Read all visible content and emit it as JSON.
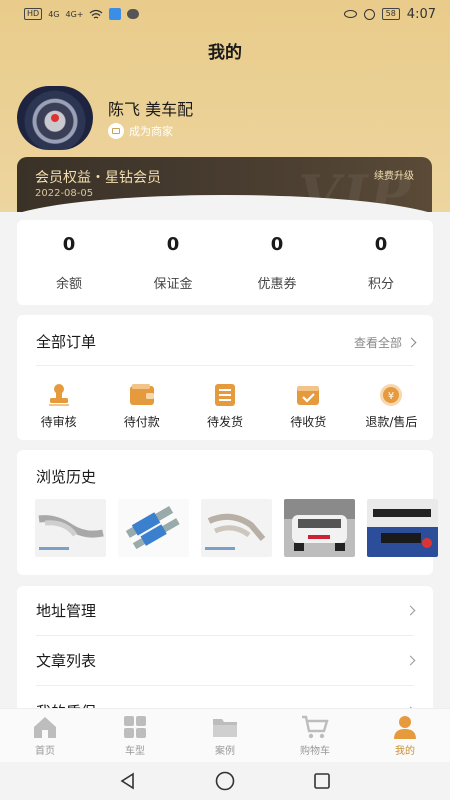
{
  "status_bar": {
    "left_badges": [
      "HD",
      "4G",
      "4G+"
    ],
    "battery": "58",
    "time": "4:07"
  },
  "page": {
    "title": "我的"
  },
  "profile": {
    "name": "陈飞 美车配",
    "merchant_label": "成为商家"
  },
  "vip": {
    "title": "会员权益・星钻会员",
    "date": "2022-08-05",
    "renew_label": "续费升级",
    "watermark": "VIP"
  },
  "stats": [
    {
      "value": "0",
      "label": "余额"
    },
    {
      "value": "0",
      "label": "保证金"
    },
    {
      "value": "0",
      "label": "优惠券"
    },
    {
      "value": "0",
      "label": "积分"
    }
  ],
  "orders": {
    "title": "全部订单",
    "see_all": "查看全部",
    "items": [
      {
        "label": "待审核",
        "icon": "stamp-icon"
      },
      {
        "label": "待付款",
        "icon": "wallet-icon"
      },
      {
        "label": "待发货",
        "icon": "list-icon"
      },
      {
        "label": "待收货",
        "icon": "box-check-icon"
      },
      {
        "label": "退款/售后",
        "icon": "refund-icon"
      }
    ]
  },
  "history": {
    "title": "浏览历史",
    "items": [
      "exhaust-pipe",
      "coilover-shocks",
      "exhaust-manifold",
      "white-suv-rear",
      "rear-diffuser"
    ]
  },
  "menu": [
    {
      "label": "地址管理"
    },
    {
      "label": "文章列表"
    },
    {
      "label": "我的质保"
    }
  ],
  "tabs": [
    {
      "label": "首页",
      "icon": "home-icon",
      "active": false
    },
    {
      "label": "车型",
      "icon": "grid-icon",
      "active": false
    },
    {
      "label": "案例",
      "icon": "folder-icon",
      "active": false
    },
    {
      "label": "购物车",
      "icon": "cart-icon",
      "active": false
    },
    {
      "label": "我的",
      "icon": "person-icon",
      "active": true
    }
  ],
  "colors": {
    "header": "#e9cc8b",
    "vip_bg": "#3f352a",
    "accent": "#e69a3e",
    "active_tab": "#c9902f"
  }
}
